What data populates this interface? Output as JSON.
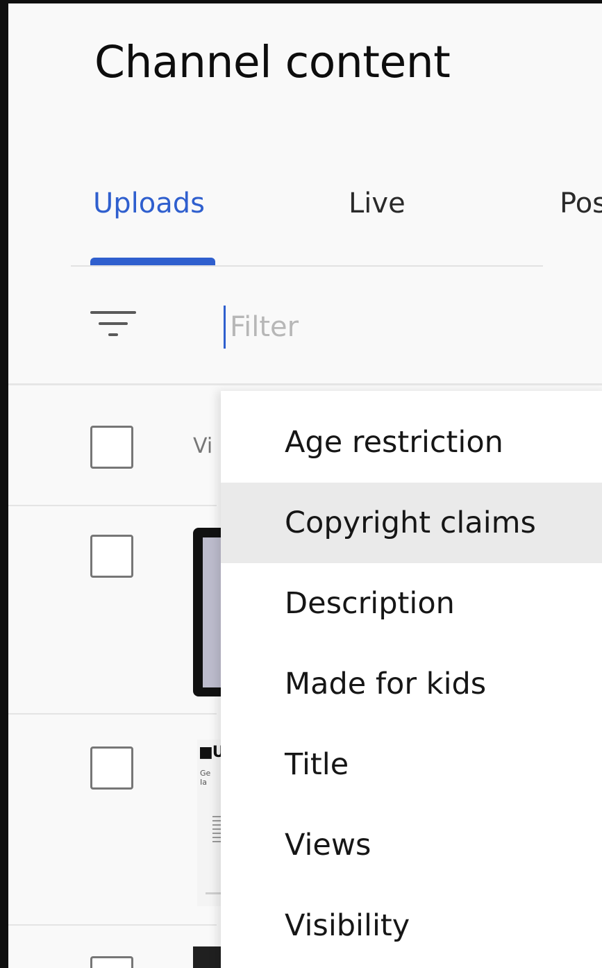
{
  "page": {
    "title": "Channel content"
  },
  "tabs": [
    {
      "label": "Uploads",
      "active": true
    },
    {
      "label": "Live",
      "active": false
    },
    {
      "label": "Pos",
      "active": false
    }
  ],
  "filter": {
    "placeholder": "Filter",
    "value": ""
  },
  "table": {
    "column_header": "Vi"
  },
  "filter_menu": {
    "items": [
      "Age restriction",
      "Copyright claims",
      "Description",
      "Made for kids",
      "Title",
      "Views",
      "Visibility"
    ],
    "highlighted": "Copyright claims"
  },
  "thumbnails": {
    "logo_text": "U",
    "tiny_text_1": "Ge",
    "tiny_text_2": "Ia"
  },
  "colors": {
    "accent": "#2f5fce",
    "background": "#f9f9f9",
    "text": "#0d0d0d",
    "menu_hover": "#eaeaea"
  },
  "icons": {
    "filter": "filter-lines-icon",
    "checkbox": "checkbox-icon"
  }
}
